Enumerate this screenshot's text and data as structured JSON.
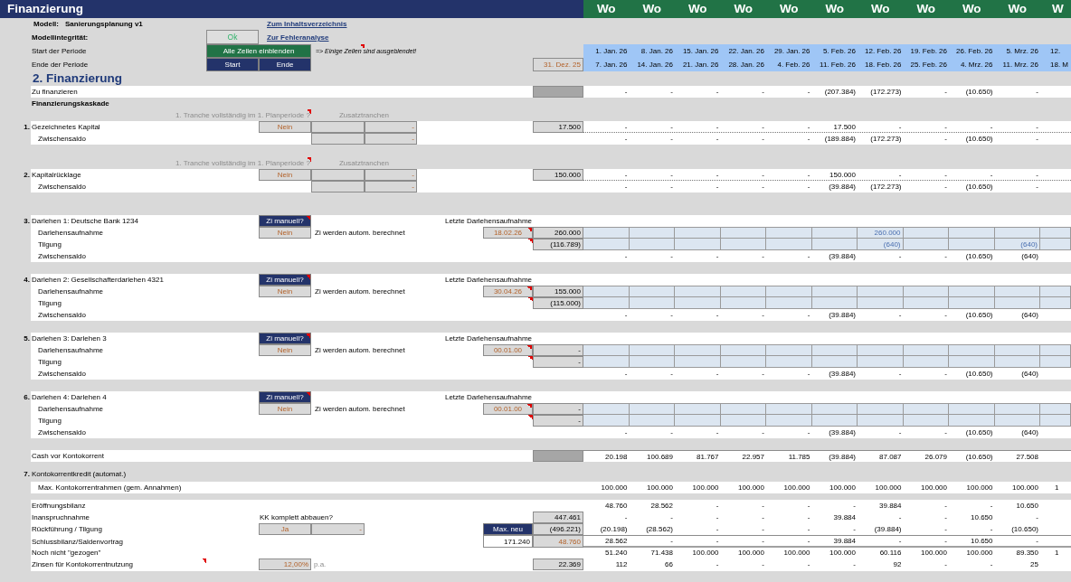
{
  "title_bar": {
    "title": "Finanzierung",
    "week_headers": [
      "Wo",
      "Wo",
      "Wo",
      "Wo",
      "Wo",
      "Wo",
      "Wo",
      "Wo",
      "Wo",
      "Wo",
      "W"
    ]
  },
  "model_line": {
    "label": "Modell:",
    "name": "Sanierungsplanung v1",
    "link": "Zum Inhaltsverzeichnis"
  },
  "integrity_line": {
    "label": "Modellintegrität:",
    "status": "Ok",
    "link": "Zur Fehleranalyse"
  },
  "period": {
    "start_label": "Start der Periode",
    "show_rows_button": "Alle Zeilen einblenden",
    "hidden_rows_note": "=> Einige Zeilen sind ausgeblendet!",
    "hidden_rows_comment": true,
    "week_starts": [
      "1. Jan. 26",
      "8. Jan. 26",
      "15. Jan. 26",
      "22. Jan. 26",
      "29. Jan. 26",
      "5. Feb. 26",
      "12. Feb. 26",
      "19. Feb. 26",
      "26. Feb. 26",
      "5. Mrz. 26",
      "12."
    ],
    "end_label": "Ende der Periode",
    "start_button": "Start",
    "end_button": "Ende",
    "end_date": "31. Dez. 25",
    "week_ends": [
      "7. Jan. 26",
      "14. Jan. 26",
      "21. Jan. 26",
      "28. Jan. 26",
      "4. Feb. 26",
      "11. Feb. 26",
      "18. Feb. 26",
      "25. Feb. 26",
      "4. Mrz. 26",
      "11. Mrz. 26",
      "18. M"
    ]
  },
  "section_title": "2. Finanzierung",
  "to_finance": {
    "label": "Zu finanzieren",
    "weeks": [
      "-",
      "-",
      "-",
      "-",
      "-",
      "(207.384)",
      "(172.273)",
      "-",
      "(10.650)",
      "-"
    ]
  },
  "cascade_title": "Finanzierungskaskade",
  "equity": [
    {
      "question": "1. Tranche vollständig im 1. Planperiode ?",
      "question_comment": true,
      "extra_label": "Zusatztranchen",
      "number": "1.",
      "name": "Gezeichnetes Kapital",
      "answer": "Nein",
      "extra_value": "-",
      "total": "17.500",
      "weeks": [
        "-",
        "-",
        "-",
        "-",
        "-",
        "17.500",
        "-",
        "-",
        "-",
        "-"
      ],
      "subtotal": {
        "label": "Zwischensaldo",
        "extra_value": "-",
        "weeks": [
          "-",
          "-",
          "-",
          "-",
          "-",
          "(189.884)",
          "(172.273)",
          "-",
          "(10.650)",
          "-"
        ]
      }
    },
    {
      "question": "1. Tranche vollständig im 1. Planperiode ?",
      "question_comment": true,
      "extra_label": "Zusatztranchen",
      "number": "2.",
      "name": "Kapitalrücklage",
      "answer": "Nein",
      "extra_value": "-",
      "total": "150.000",
      "weeks": [
        "-",
        "-",
        "-",
        "-",
        "-",
        "150.000",
        "-",
        "-",
        "-",
        "-"
      ],
      "subtotal": {
        "label": "Zwischensaldo",
        "extra_value": "-",
        "weeks": [
          "-",
          "-",
          "-",
          "-",
          "-",
          "(39.884)",
          "(172.273)",
          "-",
          "(10.650)",
          "-"
        ]
      }
    }
  ],
  "loans": [
    {
      "number": "3.",
      "name": "Darlehen 1: Deutsche Bank 1234",
      "manual_button": "Zi manuell?",
      "manual_comment": true,
      "last_draw_label": "Letzte Darlehensaufnahme",
      "draw": {
        "label": "Darlehensaufnahme",
        "manual": "Nein",
        "auto_note": "Zi werden autom. berechnet",
        "last_date": "18.02.26",
        "date_comment": true,
        "total": "260.000",
        "entries": [
          {
            "kind": "input"
          },
          {
            "kind": "input"
          },
          {
            "kind": "input"
          },
          {
            "kind": "input"
          },
          {
            "kind": "input"
          },
          {
            "kind": "input"
          },
          {
            "kind": "input",
            "value": "260.000"
          },
          {
            "kind": "input"
          },
          {
            "kind": "input"
          },
          {
            "kind": "input"
          },
          {
            "kind": "input"
          }
        ]
      },
      "repay": {
        "label": "Tilgung",
        "comment": true,
        "total": "(116.789)",
        "entries": [
          {
            "kind": "input"
          },
          {
            "kind": "input"
          },
          {
            "kind": "input"
          },
          {
            "kind": "input"
          },
          {
            "kind": "input"
          },
          {
            "kind": "input"
          },
          {
            "kind": "input",
            "value": "(640)"
          },
          {
            "kind": "input"
          },
          {
            "kind": "input"
          },
          {
            "kind": "input",
            "value": "(640)"
          },
          {
            "kind": "input"
          }
        ]
      },
      "subtotal": {
        "label": "Zwischensaldo",
        "weeks": [
          "-",
          "-",
          "-",
          "-",
          "-",
          "(39.884)",
          "-",
          "-",
          "(10.650)",
          "(640)"
        ]
      }
    },
    {
      "number": "4.",
      "name": "Darlehen 2: Gesellschafterdarlehen 4321",
      "manual_button": "Zi manuell?",
      "manual_comment": true,
      "last_draw_label": "Letzte Darlehensaufnahme",
      "draw": {
        "label": "Darlehensaufnahme",
        "manual": "Nein",
        "auto_note": "Zi werden autom. berechnet",
        "last_date": "30.04.26",
        "date_comment": true,
        "total": "155.000",
        "entries": [
          {
            "kind": "input"
          },
          {
            "kind": "input"
          },
          {
            "kind": "input"
          },
          {
            "kind": "input"
          },
          {
            "kind": "input"
          },
          {
            "kind": "input"
          },
          {
            "kind": "input"
          },
          {
            "kind": "input"
          },
          {
            "kind": "input"
          },
          {
            "kind": "input"
          },
          {
            "kind": "input"
          }
        ]
      },
      "repay": {
        "label": "Tilgung",
        "comment": true,
        "total": "(115.000)",
        "entries": [
          {
            "kind": "input"
          },
          {
            "kind": "input"
          },
          {
            "kind": "input"
          },
          {
            "kind": "input"
          },
          {
            "kind": "input"
          },
          {
            "kind": "input"
          },
          {
            "kind": "input"
          },
          {
            "kind": "input"
          },
          {
            "kind": "input"
          },
          {
            "kind": "input"
          },
          {
            "kind": "input"
          }
        ]
      },
      "subtotal": {
        "label": "Zwischensaldo",
        "weeks": [
          "-",
          "-",
          "-",
          "-",
          "-",
          "(39.884)",
          "-",
          "-",
          "(10.650)",
          "(640)"
        ]
      }
    },
    {
      "number": "5.",
      "name": "Darlehen 3: Darlehen 3",
      "manual_button": "Zi manuell?",
      "manual_comment": true,
      "last_draw_label": "Letzte Darlehensaufnahme",
      "draw": {
        "label": "Darlehensaufnahme",
        "manual": "Nein",
        "auto_note": "Zi werden autom. berechnet",
        "last_date": "00.01.00",
        "date_comment": true,
        "total": "-",
        "entries": [
          {
            "kind": "input"
          },
          {
            "kind": "input"
          },
          {
            "kind": "input"
          },
          {
            "kind": "input"
          },
          {
            "kind": "input"
          },
          {
            "kind": "input"
          },
          {
            "kind": "input"
          },
          {
            "kind": "input"
          },
          {
            "kind": "input"
          },
          {
            "kind": "input"
          },
          {
            "kind": "input"
          }
        ]
      },
      "repay": {
        "label": "Tilgung",
        "comment": true,
        "total": "-",
        "entries": [
          {
            "kind": "input"
          },
          {
            "kind": "input"
          },
          {
            "kind": "input"
          },
          {
            "kind": "input"
          },
          {
            "kind": "input"
          },
          {
            "kind": "input"
          },
          {
            "kind": "input"
          },
          {
            "kind": "input"
          },
          {
            "kind": "input"
          },
          {
            "kind": "input"
          },
          {
            "kind": "input"
          }
        ]
      },
      "subtotal": {
        "label": "Zwischensaldo",
        "weeks": [
          "-",
          "-",
          "-",
          "-",
          "-",
          "(39.884)",
          "-",
          "-",
          "(10.650)",
          "(640)"
        ]
      }
    },
    {
      "number": "6.",
      "name": "Darlehen 4: Darlehen 4",
      "manual_button": "Zi manuell?",
      "manual_comment": true,
      "last_draw_label": "Letzte Darlehensaufnahme",
      "draw": {
        "label": "Darlehensaufnahme",
        "manual": "Nein",
        "auto_note": "Zi werden autom. berechnet",
        "last_date": "00.01.00",
        "date_comment": true,
        "total": "-",
        "entries": [
          {
            "kind": "input"
          },
          {
            "kind": "input"
          },
          {
            "kind": "input"
          },
          {
            "kind": "input"
          },
          {
            "kind": "input"
          },
          {
            "kind": "input"
          },
          {
            "kind": "input"
          },
          {
            "kind": "input"
          },
          {
            "kind": "input"
          },
          {
            "kind": "input"
          },
          {
            "kind": "input"
          }
        ]
      },
      "repay": {
        "label": "Tilgung",
        "comment": true,
        "total": "-",
        "entries": [
          {
            "kind": "input"
          },
          {
            "kind": "input"
          },
          {
            "kind": "input"
          },
          {
            "kind": "input"
          },
          {
            "kind": "input"
          },
          {
            "kind": "input"
          },
          {
            "kind": "input"
          },
          {
            "kind": "input"
          },
          {
            "kind": "input"
          },
          {
            "kind": "input"
          },
          {
            "kind": "input"
          }
        ]
      },
      "subtotal": {
        "label": "Zwischensaldo",
        "weeks": [
          "-",
          "-",
          "-",
          "-",
          "-",
          "(39.884)",
          "-",
          "-",
          "(10.650)",
          "(640)"
        ]
      }
    }
  ],
  "cash_before_overdraft": {
    "label": "Cash vor Kontokorrent",
    "weeks": [
      "20.198",
      "100.689",
      "81.767",
      "22.957",
      "11.785",
      "(39.884)",
      "87.087",
      "26.079",
      "(10.650)",
      "27.508"
    ]
  },
  "overdraft": {
    "number": "7.",
    "title": "Kontokorrentkredit (automat.)",
    "limit": {
      "label": "Max. Kontokorrentrahmen (gem. Annahmen)",
      "weeks": [
        "100.000",
        "100.000",
        "100.000",
        "100.000",
        "100.000",
        "100.000",
        "100.000",
        "100.000",
        "100.000",
        "100.000",
        "1"
      ]
    },
    "rows": [
      {
        "kind": "opening",
        "label": "Eröffnungsbilanz",
        "weeks": [
          "48.760",
          "28.562",
          "-",
          "-",
          "-",
          "-",
          "39.884",
          "-",
          "-",
          "10.650"
        ]
      },
      {
        "kind": "draw",
        "label": "Inanspruchnahme",
        "question": "KK komplett abbauen?",
        "total": "447.461",
        "weeks": [
          "-",
          "-",
          "-",
          "-",
          "-",
          "39.884",
          "-",
          "-",
          "10.650",
          "-"
        ]
      },
      {
        "kind": "repay",
        "label": "Rückführung / Tilgung",
        "answer": "Ja",
        "answer_extra": "-",
        "button": "Max. neu",
        "total": "(496.221)",
        "weeks": [
          "(20.198)",
          "(28.562)",
          "-",
          "-",
          "-",
          "-",
          "(39.884)",
          "-",
          "-",
          "(10.650)"
        ]
      },
      {
        "kind": "closing",
        "label": "Schlussbilanz/Saldenvortrag",
        "side_value": "171.240",
        "total": "48.760",
        "weeks": [
          "28.562",
          "-",
          "-",
          "-",
          "-",
          "39.884",
          "-",
          "-",
          "10.650",
          "-"
        ]
      },
      {
        "kind": "undrawn",
        "label": "Noch nicht \"gezogen\"",
        "weeks": [
          "51.240",
          "71.438",
          "100.000",
          "100.000",
          "100.000",
          "100.000",
          "60.116",
          "100.000",
          "100.000",
          "89.350",
          "1"
        ]
      },
      {
        "kind": "interest",
        "label": "Zinsen für Kontokorrentnutzung",
        "comment": true,
        "rate": "12,00%",
        "rate_unit": "p.a.",
        "total": "22.369",
        "weeks": [
          "112",
          "66",
          "-",
          "-",
          "-",
          "-",
          "92",
          "-",
          "-",
          "25"
        ]
      }
    ]
  }
}
